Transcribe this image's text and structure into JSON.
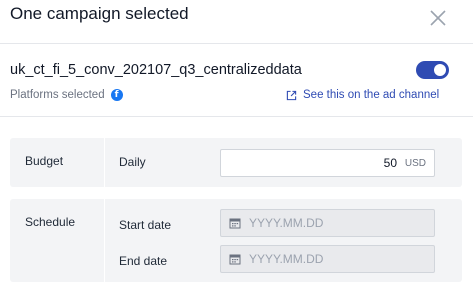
{
  "header": {
    "title": "One campaign selected",
    "close_icon": "close-icon"
  },
  "campaign": {
    "name": "uk_ct_fi_5_conv_202107_q3_centralizeddata",
    "enabled": true,
    "platforms_label": "Platforms selected",
    "platform_icon": "facebook-icon",
    "ad_channel_link": "See this on the ad channel",
    "ad_channel_icon": "external-link-icon"
  },
  "budget": {
    "section_label": "Budget",
    "field_label": "Daily",
    "value": "50",
    "currency": "USD"
  },
  "schedule": {
    "section_label": "Schedule",
    "start_label": "Start date",
    "start_placeholder": "YYYY.MM.DD",
    "end_label": "End date",
    "end_placeholder": "YYYY.MM.DD",
    "calendar_icon": "calendar-icon"
  },
  "colors": {
    "accent": "#2f4bb3",
    "facebook": "#1877f2",
    "panel_bg": "#f3f4f6",
    "disabled_input_bg": "#e9eaed"
  }
}
